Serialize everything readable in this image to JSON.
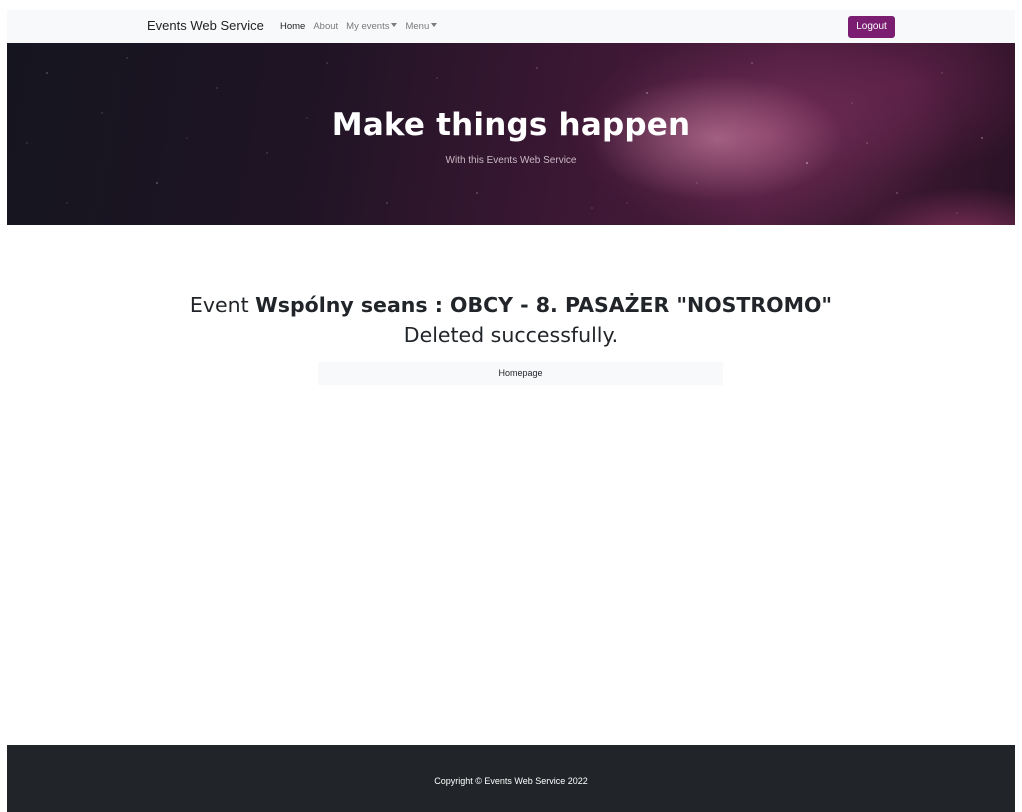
{
  "navbar": {
    "brand": "Events Web Service",
    "links": [
      {
        "label": "Home",
        "active": true
      },
      {
        "label": "About",
        "active": false
      },
      {
        "label": "My events",
        "active": false,
        "dropdown": true
      },
      {
        "label": "Menu",
        "active": false,
        "dropdown": true
      }
    ],
    "logout_label": "Logout"
  },
  "hero": {
    "title": "Make things happen",
    "subtitle": "With this Events Web Service"
  },
  "main": {
    "prefix": "Event",
    "event_name": "Wspólny seans : OBCY - 8. PASAŻER \"NOSTROMO\"",
    "status_line": "Deleted successfully.",
    "homepage_label": "Homepage"
  },
  "footer": {
    "copyright": "Copyright © Events Web Service 2022"
  },
  "colors": {
    "accent": "#7b1e72",
    "navbar_bg": "#f8f9fa",
    "footer_bg": "#212529"
  }
}
